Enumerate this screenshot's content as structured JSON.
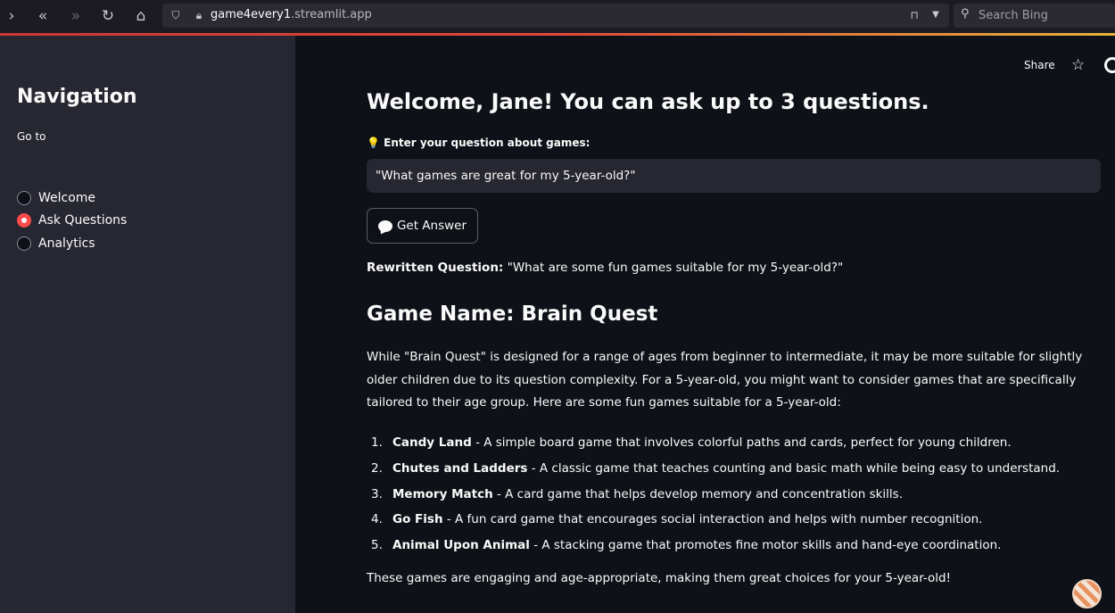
{
  "browser": {
    "url_domain": "game4every1",
    "url_rest": ".streamlit.app",
    "search_placeholder": "Search Bing",
    "nav_icons": [
      "chevron-right-icon",
      "double-chevron-left-icon",
      "double-chevron-right-icon",
      "reload-icon",
      "home-icon"
    ]
  },
  "sidebar": {
    "title": "Navigation",
    "goto_label": "Go to",
    "options": [
      {
        "label": "Welcome",
        "selected": false
      },
      {
        "label": "Ask Questions",
        "selected": true
      },
      {
        "label": "Analytics",
        "selected": false
      }
    ]
  },
  "header": {
    "share_label": "Share"
  },
  "main": {
    "title": "Welcome, Jane! You can ask up to 3 questions.",
    "question_label": "💡 Enter your question about games:",
    "question_value": "\"What games are great for my 5-year-old?\"",
    "button_label": "Get Answer",
    "rewritten_label": "Rewritten Question:",
    "rewritten_text": " \"What are some fun games suitable for my 5-year-old?\"",
    "game_heading": "Game Name: Brain Quest",
    "paragraph": "While \"Brain Quest\" is designed for a range of ages from beginner to intermediate, it may be more suitable for slightly older children due to its question complexity. For a 5-year-old, you might want to consider games that are specifically tailored to their age group. Here are some fun games suitable for a 5-year-old:",
    "games": [
      {
        "num": "1.",
        "name": "Candy Land",
        "desc": " - A simple board game that involves colorful paths and cards, perfect for young children."
      },
      {
        "num": "2.",
        "name": "Chutes and Ladders",
        "desc": " - A classic game that teaches counting and basic math while being easy to understand."
      },
      {
        "num": "3.",
        "name": "Memory Match",
        "desc": " - A card game that helps develop memory and concentration skills."
      },
      {
        "num": "4.",
        "name": "Go Fish",
        "desc": " - A fun card game that encourages social interaction and helps with number recognition."
      },
      {
        "num": "5.",
        "name": "Animal Upon Animal",
        "desc": " - A stacking game that promotes fine motor skills and hand-eye coordination."
      }
    ],
    "closing": "These games are engaging and age-appropriate, making them great choices for your 5-year-old!"
  },
  "colors": {
    "background": "#0e1117",
    "sidebar": "#262730",
    "accent": "#ff4b4b",
    "text": "#fafafa"
  }
}
